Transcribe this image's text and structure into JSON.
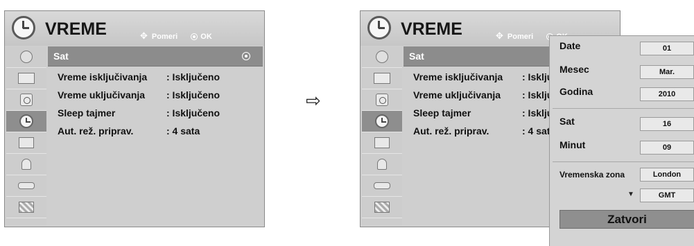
{
  "menu_title": "VREME",
  "hint": {
    "move": "Pomeri",
    "ok": "OK"
  },
  "selected_item": "Sat",
  "rows": [
    {
      "label": "Vreme isključivanja",
      "value": ": Isključeno"
    },
    {
      "label": "Vreme uključivanja",
      "value": ": Isključeno"
    },
    {
      "label": "Sleep tajmer",
      "value": ": Isključeno"
    },
    {
      "label": "Aut. rež. priprav.",
      "value": ": 4 sata"
    }
  ],
  "rows_truncated": [
    {
      "label": "Vreme isključivanja",
      "value": ": Isklju"
    },
    {
      "label": "Vreme uključivanja",
      "value": ": Isklju"
    },
    {
      "label": "Sleep tajmer",
      "value": ": Isklju"
    },
    {
      "label": "Aut. rež. priprav.",
      "value": ": 4 sata"
    }
  ],
  "transition_arrow": "⇨",
  "sidebar_icons": [
    "satellite-icon",
    "tv-icon",
    "speaker-icon",
    "clock-icon",
    "box-icon",
    "lock-icon",
    "plug-icon",
    "film-icon"
  ],
  "popup": {
    "date_label": "Date",
    "date_value": "01",
    "month_label": "Mesec",
    "month_value": "Mar.",
    "year_label": "Godina",
    "year_value": "2010",
    "hour_label": "Sat",
    "hour_value": "16",
    "minute_label": "Minut",
    "minute_value": "09",
    "zone_label": "Vremenska zona",
    "zone_value": "London",
    "zone_offset": "GMT",
    "more_indicator": "▼",
    "close_label": "Zatvori"
  }
}
